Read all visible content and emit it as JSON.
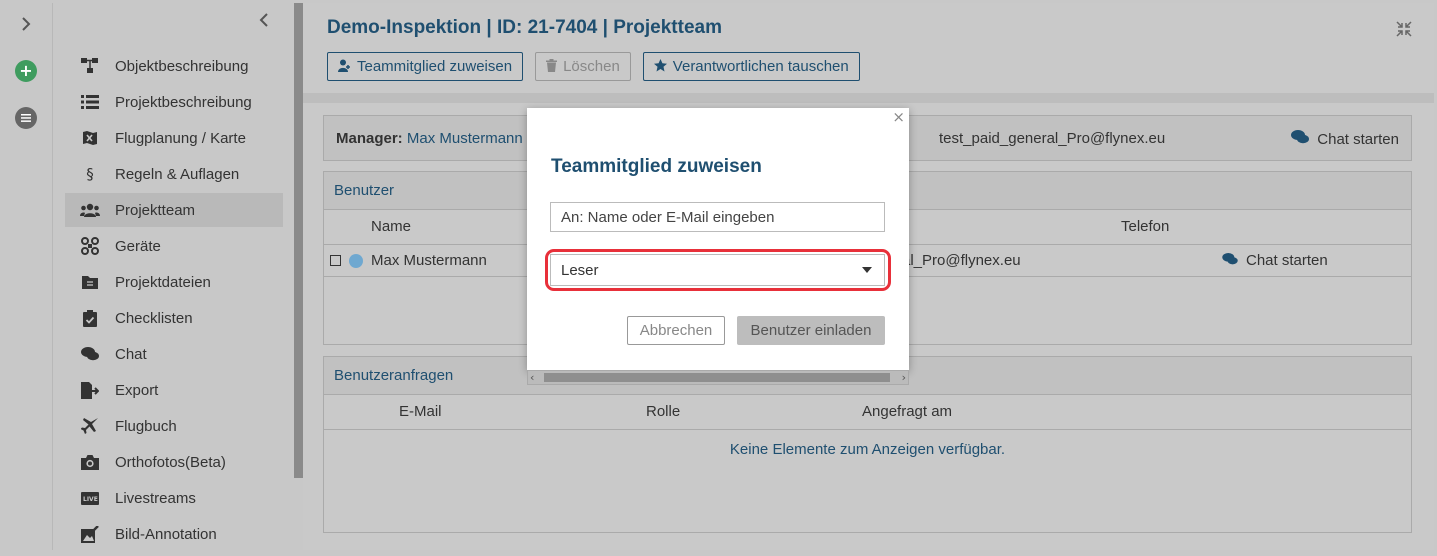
{
  "rail": {
    "expand_icon": "chevron-right",
    "add_icon": "plus",
    "list_icon": "list"
  },
  "nav": {
    "collapse_icon": "chevron-left",
    "items": [
      {
        "label": "Objektbeschreibung",
        "icon": "hierarchy"
      },
      {
        "label": "Projektbeschreibung",
        "icon": "list"
      },
      {
        "label": "Flugplanung / Karte",
        "icon": "map"
      },
      {
        "label": "Regeln & Auflagen",
        "icon": "section"
      },
      {
        "label": "Projektteam",
        "icon": "users",
        "active": true
      },
      {
        "label": "Geräte",
        "icon": "drone"
      },
      {
        "label": "Projektdateien",
        "icon": "folder"
      },
      {
        "label": "Checklisten",
        "icon": "clipboard"
      },
      {
        "label": "Chat",
        "icon": "chat"
      },
      {
        "label": "Export",
        "icon": "export"
      },
      {
        "label": "Flugbuch",
        "icon": "plane"
      },
      {
        "label": "Orthofotos(Beta)",
        "icon": "camera"
      },
      {
        "label": "Livestreams",
        "icon": "live"
      },
      {
        "label": "Bild-Annotation",
        "icon": "annotate"
      }
    ]
  },
  "header": {
    "title": "Demo-Inspektion | ID: 21-7404 | Projektteam",
    "toolbar": {
      "assign_label": "Teammitglied zuweisen",
      "delete_label": "Löschen",
      "swap_label": "Verantwortlichen tauschen"
    }
  },
  "manager": {
    "label": "Manager:",
    "name": "Max Mustermann",
    "email": "test_paid_general_Pro@flynex.eu",
    "chat_label": "Chat starten"
  },
  "users": {
    "title": "Benutzer",
    "columns": {
      "name": "Name",
      "phone": "Telefon"
    },
    "rows": [
      {
        "name": "Max Mustermann",
        "email_fragment": "al_Pro@flynex.eu",
        "chat_label": "Chat starten"
      }
    ]
  },
  "requests": {
    "title": "Benutzeranfragen",
    "columns": {
      "email": "E-Mail",
      "role": "Rolle",
      "requested": "Angefragt am"
    },
    "empty": "Keine Elemente zum Anzeigen verfügbar."
  },
  "modal": {
    "title": "Teammitglied zuweisen",
    "input_placeholder": "An: Name oder E-Mail eingeben",
    "role_value": "Leser",
    "cancel_label": "Abbrechen",
    "invite_label": "Benutzer einladen",
    "highlight_color": "#e8303a"
  },
  "colors": {
    "accent": "#1f4f70",
    "add_button": "#3f9c5f"
  }
}
